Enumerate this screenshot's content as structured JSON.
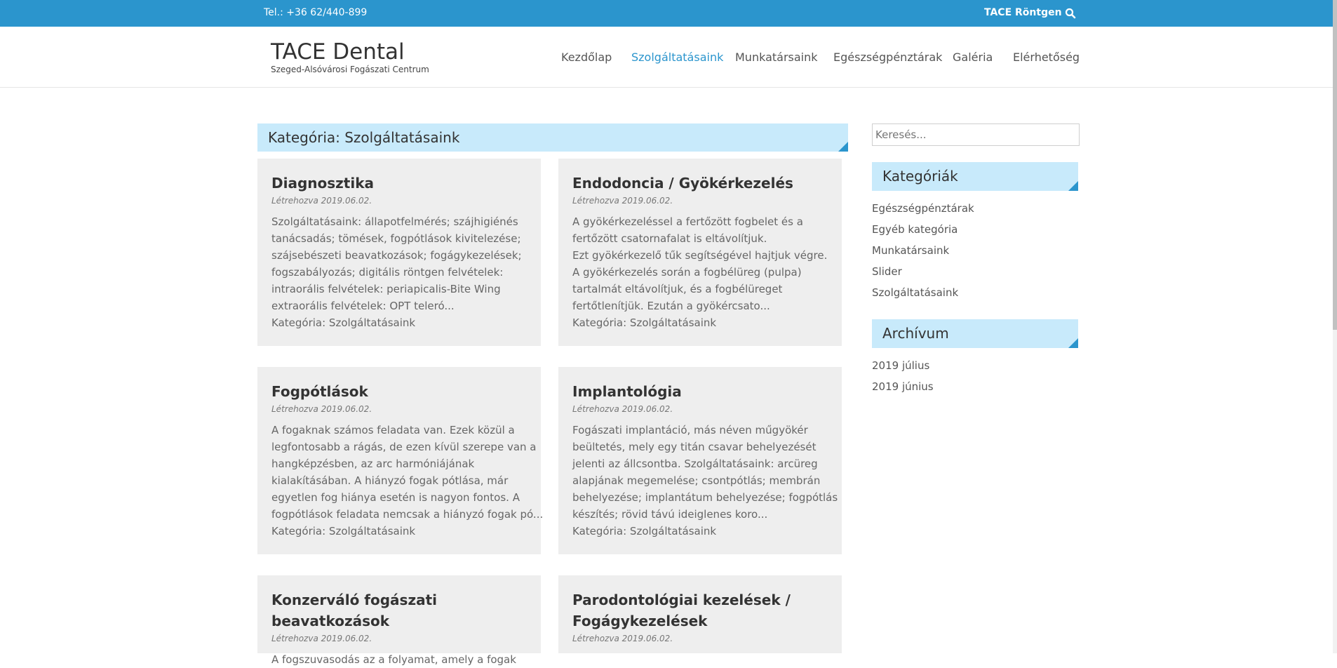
{
  "topbar": {
    "phone": "Tel.: +36 62/440-899",
    "link": "TACE Röntgen"
  },
  "header": {
    "title": "TACE Dental",
    "subtitle": "Szeged-Alsóvárosi Fogászati Centrum"
  },
  "nav": {
    "items": [
      "Kezdőlap",
      "Szolgáltatásaink",
      "Munkatársaink",
      "Egészségpénztárak",
      "Galéria",
      "Elérhetőség"
    ],
    "active": "Szolgáltatásaink"
  },
  "main": {
    "category_heading": "Kategória: Szolgáltatásaink",
    "posts": [
      {
        "title": [
          "Diagnosztika"
        ],
        "date": "Létrehozva 2019.06.02.",
        "excerpt": [
          "Szolgáltatásaink: állapotfelmérés; szájhigiénés",
          "tanácsadás; tömések, fogpótlások kivitelezése;",
          "szájsebészeti beavatkozások; fogágykezelések;",
          "fogszabályozás; digitális röntgen felvételek:",
          "intraorális felvételek: periapicalis-Bite Wing",
          "extraorális felvételek: OPT teleró..."
        ],
        "category_label": "Kategória: Szolgáltatásaink"
      },
      {
        "title": [
          "Endodoncia / Gyökérkezelés"
        ],
        "date": "Létrehozva 2019.06.02.",
        "excerpt": [
          "A gyökérkezeléssel a fertőzött fogbelet és a",
          "fertőzött csatornafalat is eltávolítjuk.",
          "Ezt gyökérkezelő tűk segítségével hajtjuk végre.",
          "A gyökérkezelés során a fogbélüreg (pulpa)",
          "tartalmát eltávolítjuk, és a fogbélüreget",
          "fertőtlenítjük. Ezután a gyökércsato..."
        ],
        "category_label": "Kategória: Szolgáltatásaink"
      },
      {
        "title": [
          "Fogpótlások"
        ],
        "date": "Létrehozva 2019.06.02.",
        "excerpt": [
          "A fogaknak számos feladata van. Ezek közül a",
          "legfontosabb a rágás, de ezen kívül szerepe van a",
          "hangképzésben, az arc harmóniájának",
          "kialakításában. A hiányzó fogak pótlása, már",
          "egyetlen fog hiánya esetén is nagyon fontos. A",
          "fogpótlások feladata nemcsak a hiányzó fogak pó..."
        ],
        "category_label": "Kategória: Szolgáltatásaink"
      },
      {
        "title": [
          "Implantológia"
        ],
        "date": "Létrehozva 2019.06.02.",
        "excerpt": [
          "Fogászati implantáció, más néven műgyökér",
          "beültetés, mely egy titán csavar behelyezését",
          "jelenti az állcsontba. Szolgáltatásaink: arcüreg",
          "alapjának megemelése; csontpótlás; membrán",
          "behelyezése; implantátum behelyezése; fogpótlás",
          "készítés; rövid távú ideiglenes koro..."
        ],
        "category_label": "Kategória: Szolgáltatásaink"
      },
      {
        "title": [
          "Konzerváló fogászati beavatkozások"
        ],
        "date": "Létrehozva 2019.06.02.",
        "excerpt": [
          "A fogszuvasodás az a folyamat, amely a fogak"
        ],
        "category_label": ""
      },
      {
        "title": [
          "Parodontológiai kezelések /",
          "Fogágykezelések"
        ],
        "date": "Létrehozva 2019.06.02.",
        "excerpt": [],
        "category_label": ""
      }
    ]
  },
  "sidebar": {
    "search_placeholder": "Keresés...",
    "categories_title": "Kategóriák",
    "categories": [
      "Egészségpénztárak",
      "Egyéb kategória",
      "Munkatársaink",
      "Slider",
      "Szolgáltatásaink"
    ],
    "archive_title": "Archívum",
    "archive": [
      "2019 július",
      "2019 június"
    ]
  },
  "colors": {
    "topbar": "#2b95cd",
    "accent": "#2b95cd",
    "heading_bg": "#c8eafb",
    "card_bg": "#eeeeee"
  }
}
